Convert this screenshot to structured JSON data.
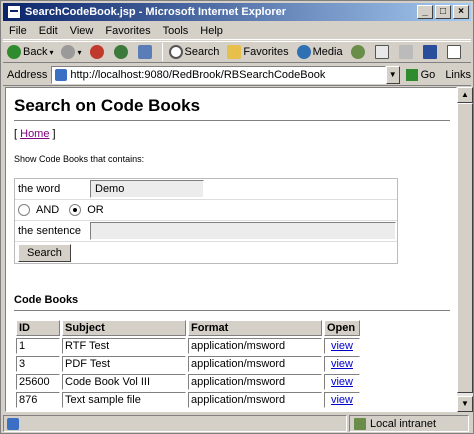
{
  "window": {
    "title": "SearchCodeBook.jsp - Microsoft Internet Explorer",
    "minimize": "_",
    "maximize": "□",
    "close": "×"
  },
  "menu": [
    "File",
    "Edit",
    "View",
    "Favorites",
    "Tools",
    "Help"
  ],
  "toolbar": {
    "back": "Back",
    "search": "Search",
    "favorites": "Favorites",
    "media": "Media"
  },
  "address": {
    "label": "Address",
    "url": "http://localhost:9080/RedBrook/RBSearchCodeBook",
    "go": "Go",
    "links": "Links"
  },
  "page": {
    "title": "Search on Code Books",
    "nav_open": "[ ",
    "home_link": "Home",
    "nav_close": " ]",
    "instruction": "Show Code Books that contains:",
    "form": {
      "word_label": "the word",
      "word_value": "Demo",
      "and_label": "AND",
      "or_label": "OR",
      "selected": "OR",
      "sentence_label": "the sentence",
      "sentence_value": "",
      "search_button": "Search"
    },
    "results_title": "Code Books",
    "columns": [
      "ID",
      "Subject",
      "Format",
      "Open"
    ],
    "rows": [
      {
        "id": "1",
        "subject": "RTF Test",
        "format": "application/msword",
        "open": "view"
      },
      {
        "id": "3",
        "subject": "PDF Test",
        "format": "application/msword",
        "open": "view"
      },
      {
        "id": "25600",
        "subject": "Code Book Vol III",
        "format": "application/msword",
        "open": "view"
      },
      {
        "id": "876",
        "subject": "Text sample file",
        "format": "application/msword",
        "open": "view"
      }
    ]
  },
  "status": {
    "zone": "Local intranet"
  }
}
